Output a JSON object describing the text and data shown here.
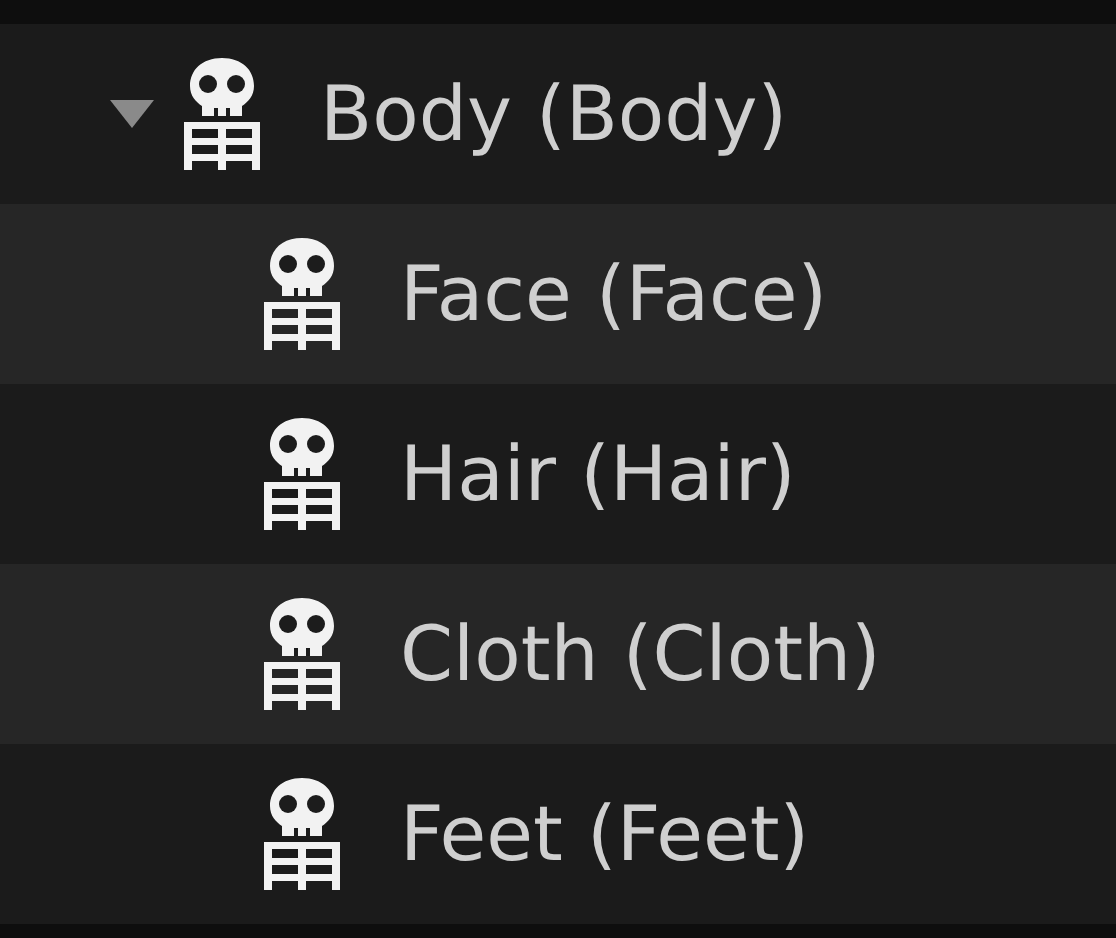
{
  "tree": [
    {
      "label": "Body (Body)",
      "expanded": true,
      "children": [
        {
          "label": "Face (Face)"
        },
        {
          "label": "Hair (Hair)"
        },
        {
          "label": "Cloth (Cloth)"
        },
        {
          "label": "Feet (Feet)"
        }
      ]
    }
  ]
}
